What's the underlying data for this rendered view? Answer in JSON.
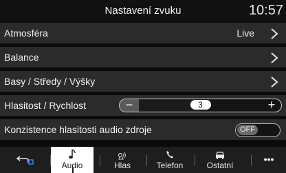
{
  "header": {
    "title": "Nastavení zvuku",
    "clock": "10:57"
  },
  "rows": [
    {
      "label": "Atmosféra",
      "value": "Live"
    },
    {
      "label": "Balance"
    },
    {
      "label": "Basy / Středy / Výšky"
    },
    {
      "label": "Hlasitost / Rychlost",
      "minus": "−",
      "plus": "+",
      "value": "3",
      "level_fraction": 0.5
    },
    {
      "label": "Konzistence hlasitosti audio zdroje",
      "toggle": "OFF"
    }
  ],
  "nav": {
    "items": [
      {
        "label": "",
        "icon": "back-icon"
      },
      {
        "label": "Audio",
        "icon": "music-note-icon",
        "active": true
      },
      {
        "label": "Hlas",
        "icon": "voice-icon"
      },
      {
        "label": "Telefon",
        "icon": "phone-icon"
      },
      {
        "label": "Ostatní",
        "icon": "car-icon"
      },
      {
        "label": "•••",
        "icon": "more-icon"
      }
    ]
  },
  "colors": {
    "background": "#0b0b0b",
    "row": "#2b2b2b",
    "active_tab": "#ffffff",
    "accent_blue": "#2f8fff"
  }
}
